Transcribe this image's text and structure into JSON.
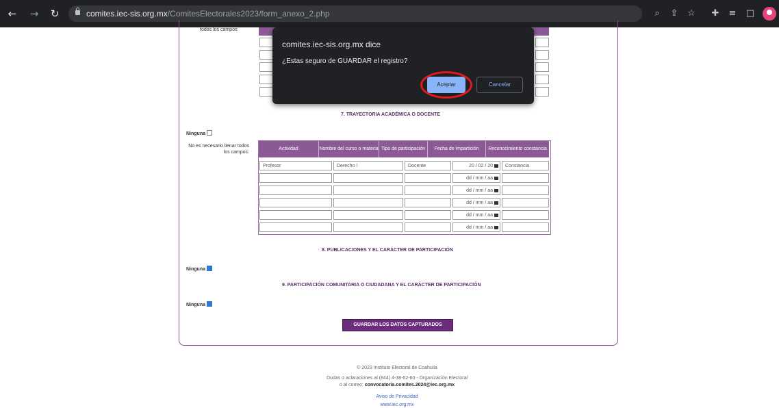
{
  "browser": {
    "url_host": "comites.iec-sis.org.mx",
    "url_path": "/ComitesElectorales2023/form_anexo_2.php"
  },
  "dialog": {
    "title": "comites.iec-sis.org.mx dice",
    "message": "¿Estas seguro de GUARDAR el registro?",
    "accept_label": "Aceptar",
    "cancel_label": "Cancelar"
  },
  "form": {
    "top_note_partial": "todos los campos:",
    "section7_title": "7. TRAYECTORIA ACADÉMICA O DOCENTE",
    "ninguna_label": "Ninguna",
    "section7_note": "No es necesario llenar todos los campos:",
    "table7_headers": [
      "Actividad",
      "Nombre del curso o materia",
      "Tipo de participación",
      "Fecha de impartición",
      "Reconocimiento constancia"
    ],
    "table7_rows": [
      [
        "Profesor",
        "Derecho I",
        "Docente",
        "20 / 02 / 20",
        "Constancia"
      ],
      [
        "",
        "",
        "",
        "dd / mm / aa",
        ""
      ],
      [
        "",
        "",
        "",
        "dd / mm / aa",
        ""
      ],
      [
        "",
        "",
        "",
        "dd / mm / aa",
        ""
      ],
      [
        "",
        "",
        "",
        "dd / mm / aa",
        ""
      ],
      [
        "",
        "",
        "",
        "dd / mm / aa",
        ""
      ]
    ],
    "section8_title": "8. PUBLICACIONES Y EL CARÁCTER DE PARTICIPACIÓN",
    "section9_title": "9. PARTICIPACIÓN COMUNITARIA O CIUDADANA Y EL CARÁCTER DE PARTICIPACIÓN",
    "save_button": "GUARDAR LOS DATOS CAPTURADOS"
  },
  "footer": {
    "copyright": "© 2023 Instituto Electoral de Coahuila",
    "contact_line1": "Dudas o aclaraciones al (844) 4-38-62-60 - Organización Electoral",
    "contact_line2_prefix": "o al correo: ",
    "contact_email": "convocatoria.comites.2024@iec.org.mx",
    "privacy": "Aviso de Privacidad",
    "site": "www.iec.org.mx"
  }
}
